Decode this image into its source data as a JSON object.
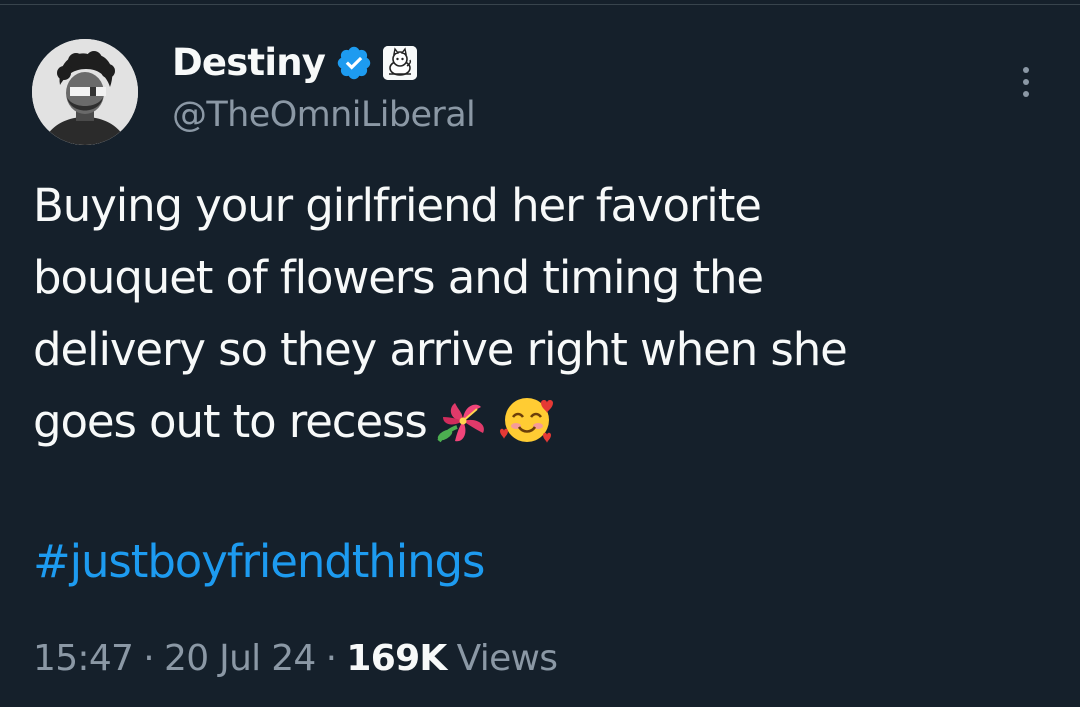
{
  "author": {
    "display_name": "Destiny",
    "handle": "@TheOmniLiberal",
    "verified_color": "#1d9bf0",
    "verified_icon": "verified-badge-icon",
    "affiliate_icon": "affiliate-badge-icon",
    "avatar": "profile-avatar"
  },
  "tweet": {
    "text_lines": [
      "Buying your girlfriend her favorite",
      "bouquet of flowers and timing the",
      "delivery so they arrive right when she",
      "goes out to recess"
    ],
    "emojis": [
      "hibiscus-emoji-icon",
      "smiling-face-with-hearts-emoji-icon"
    ],
    "hashtag": "#justboyfriendthings",
    "hashtag_color": "#1d9bf0"
  },
  "meta": {
    "time": "15:47",
    "separator": "·",
    "date": "20 Jul 24",
    "views_count": "169K",
    "views_label": "Views"
  },
  "menu": {
    "icon": "more-options-icon"
  }
}
